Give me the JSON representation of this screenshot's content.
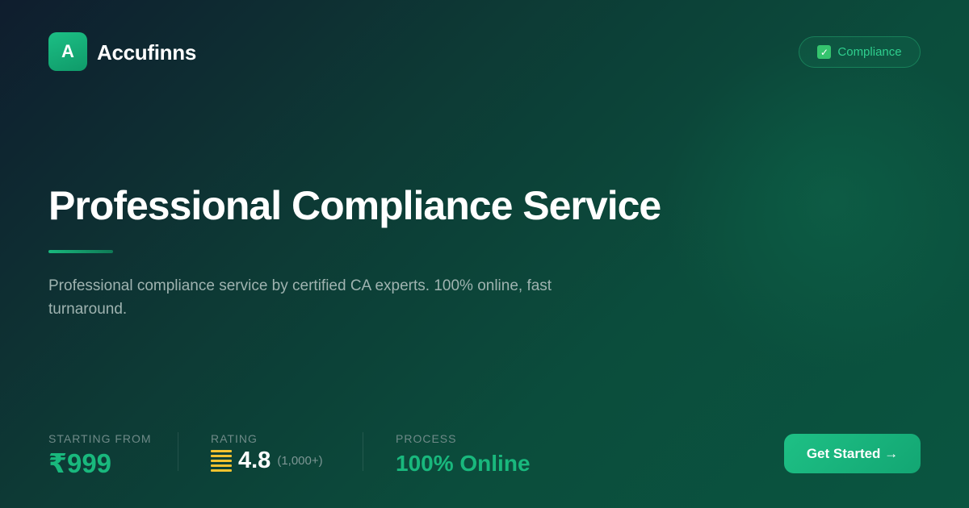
{
  "brand": {
    "logo_letter": "A",
    "name": "Accufinns"
  },
  "badge": {
    "icon": "check-box-icon",
    "label": "Compliance"
  },
  "hero": {
    "title": "Professional Compliance Service",
    "description": "Professional compliance service by certified CA experts. 100% online, fast turnaround."
  },
  "stats": {
    "price": {
      "label": "STARTING FROM",
      "value": "₹999"
    },
    "rating": {
      "label": "RATING",
      "icon": "star-bars-icon",
      "value": "4.8",
      "count": "(1,000+)"
    },
    "process": {
      "label": "PROCESS",
      "value": "100% Online"
    }
  },
  "cta": {
    "label": "Get Started →"
  },
  "colors": {
    "accent": "#19b87d",
    "rating": "#f2c230",
    "background_start": "#0f1d2e",
    "background_end": "#0a5540"
  }
}
